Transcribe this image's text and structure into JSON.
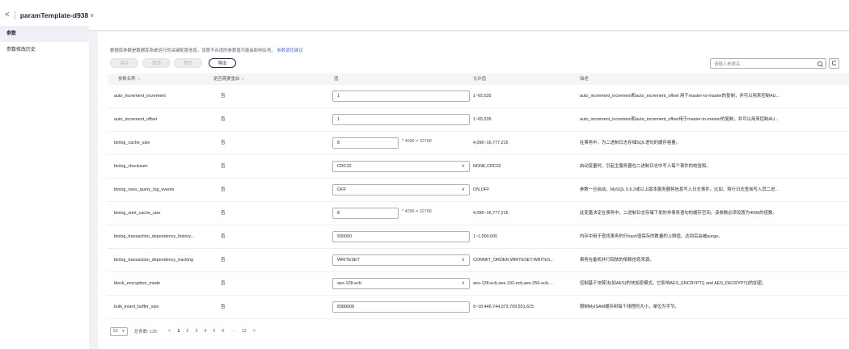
{
  "header": {
    "back_glyph": "<",
    "title": "paramTemplate-d938",
    "chevron_glyph": "∨"
  },
  "sidebar": {
    "items": [
      {
        "label": "参数"
      },
      {
        "label": "参数修改历史"
      }
    ]
  },
  "description": {
    "text": "数据库参数是数据库系统运行的关键配置信息，设置不合适的参数值可能会影响业务。",
    "link": "参数调优建议"
  },
  "toolbar": {
    "save_label": "保存",
    "cancel_label": "取消",
    "preview_label": "预览",
    "export_label": "导出",
    "refresh_glyph": "C"
  },
  "search": {
    "placeholder": "请输入参数名"
  },
  "table": {
    "headers": {
      "name": "参数名称",
      "restart": "是否需要重启",
      "value": "值",
      "allowed": "允许值",
      "desc": "描述"
    },
    "sort_glyph": "⇕",
    "rows": [
      {
        "name": "auto_increment_increment",
        "restart": "否",
        "value": "1",
        "select": false,
        "multiplier": "",
        "allowed": "1~65,535",
        "desc": "auto_increment_increment和auto_increment_offset 用于master-to-master的复制，并可以用来控制AU..."
      },
      {
        "name": "auto_increment_offset",
        "restart": "否",
        "value": "1",
        "select": false,
        "multiplier": "",
        "allowed": "1~65,535",
        "desc": "auto_increment_increment和auto_increment_offset用于master-to-master的复制，并可以用来控制AU..."
      },
      {
        "name": "binlog_cache_size",
        "restart": "否",
        "value": "8",
        "select": false,
        "multiplier": "* 4096 = 32768",
        "allowed": "4,096~16,777,216",
        "desc": "在事务中，为二进制日志存储SQL语句的缓存容量。"
      },
      {
        "name": "binlog_checksum",
        "restart": "否",
        "value": "CRC32",
        "select": true,
        "multiplier": "",
        "allowed": "NONE,CRC32",
        "desc": "启动变量时，引起主服务器在二进制日志中写入每个事件的校验和。"
      },
      {
        "name": "binlog_rows_query_log_events",
        "restart": "否",
        "value": "OFF",
        "select": true,
        "multiplier": "",
        "allowed": "ON,OFF",
        "desc": "参数一旦启动，MySQL 5.6.2或以上版本服务器将信息写入日志事件，比如、将行日志查询写入其二进..."
      },
      {
        "name": "binlog_stmt_cache_size",
        "restart": "否",
        "value": "8",
        "select": false,
        "multiplier": "* 4096 = 32768",
        "allowed": "4,096~16,777,216",
        "desc": "此变量决定在事务中，二进制日志存储下发的非事务语句的缓存空间。该参数必须设置为4096的倍数。"
      },
      {
        "name": "binlog_transaction_dependency_history...",
        "restart": "否",
        "value": "500000",
        "select": false,
        "multiplier": "",
        "allowed": "1~1,000,000",
        "desc": "内存中用于查找事务的行hash值保存的数量的上限值，达到后会被purge。"
      },
      {
        "name": "binlog_transaction_dependency_tracking",
        "restart": "否",
        "value": "WRITESET",
        "select": true,
        "multiplier": "",
        "allowed": "COMMIT_ORDER,WRITESET,WRITES...",
        "desc": "事务在备机并行回放的依赖信息来源。"
      },
      {
        "name": "block_encryption_mode",
        "restart": "否",
        "value": "aes-128-ecb",
        "select": true,
        "multiplier": "",
        "allowed": "aes-128-ecb,aes-192-ecb,aes-256-ecb,...",
        "desc": "控制基于块算法(如AES)的块加密模式。它影响AES_ENCRYPT() and AES_DECRYPT()的加密。"
      },
      {
        "name": "bulk_insert_buffer_size",
        "restart": "否",
        "value": "8388608",
        "select": false,
        "multiplier": "",
        "allowed": "0~18,446,744,073,709,551,615",
        "desc": "限制MyISAM缓存树每个线程的大小，单位为字节。"
      }
    ]
  },
  "pagination": {
    "page_size": "10",
    "total_label": "总条数: 126",
    "prev": "<",
    "pages": [
      "1",
      "2",
      "3",
      "4",
      "5",
      "6",
      "···",
      "13"
    ],
    "next": ">"
  }
}
